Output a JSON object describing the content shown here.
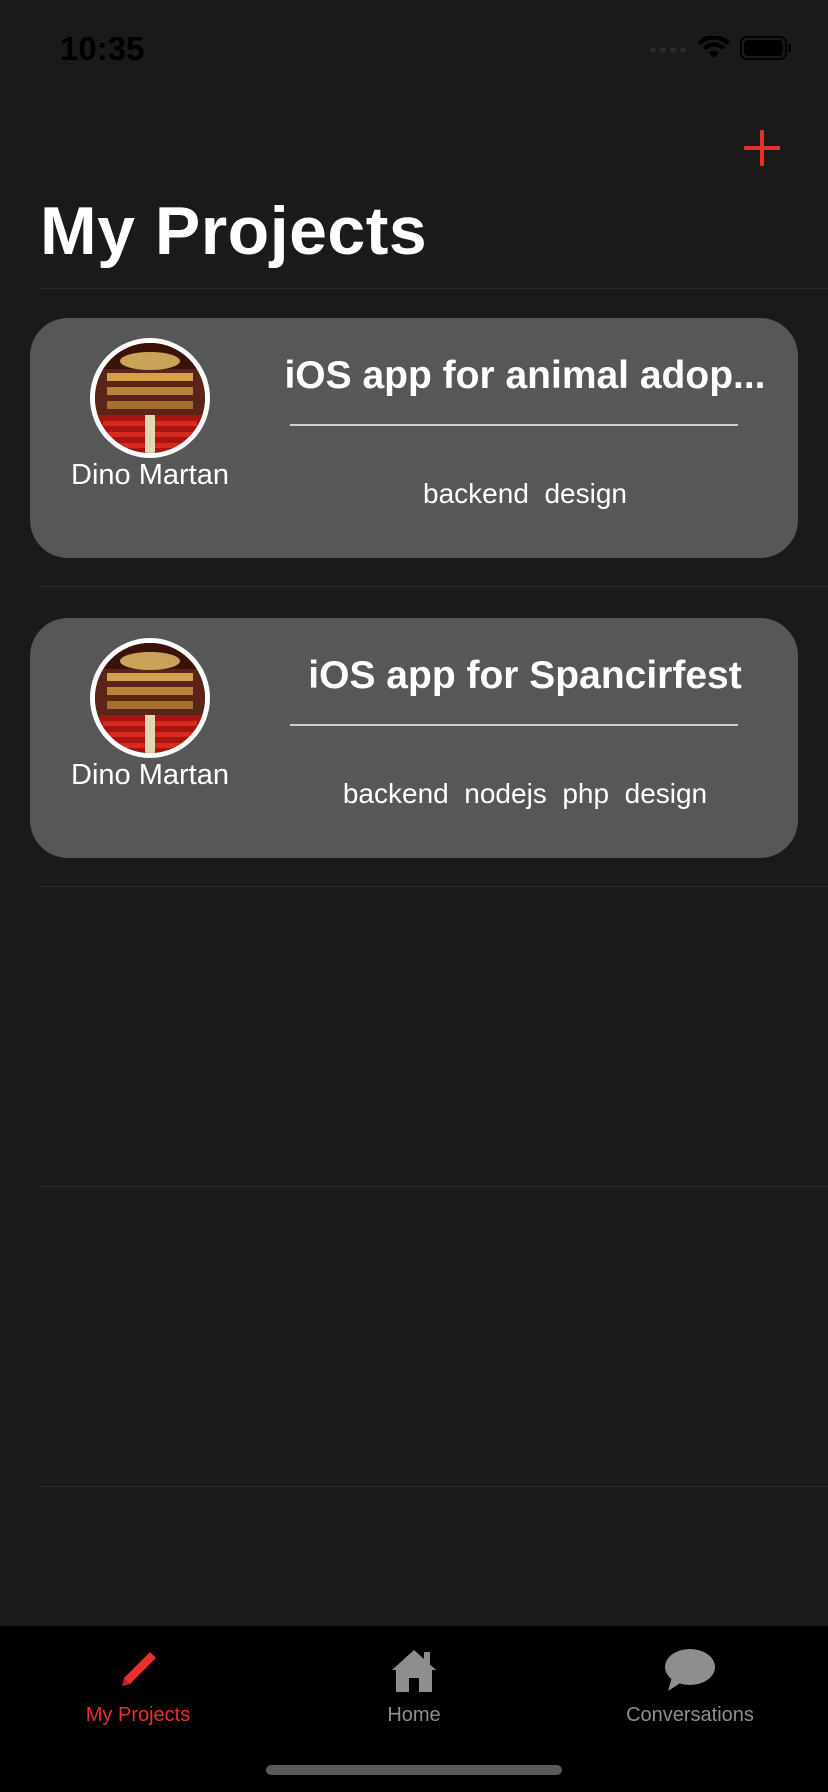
{
  "status_bar": {
    "time": "10:35"
  },
  "nav": {
    "title": "My Projects",
    "add_icon": "plus-icon"
  },
  "projects": [
    {
      "owner_name": "Dino Martan",
      "title": "iOS app for animal adop...",
      "tags": "backend  design"
    },
    {
      "owner_name": "Dino Martan",
      "title": "iOS app for Spancirfest",
      "tags": "backend  nodejs  php  design"
    }
  ],
  "tab_bar": {
    "tabs": [
      {
        "label": "My Projects",
        "icon": "pencil-icon",
        "selected": true
      },
      {
        "label": "Home",
        "icon": "house-icon",
        "selected": false
      },
      {
        "label": "Conversations",
        "icon": "speech-bubble-icon",
        "selected": false
      }
    ]
  },
  "colors": {
    "accent": "#e8302c",
    "background": "#1a1a1a",
    "card": "#575757",
    "tab_inactive": "#8e8e8e"
  }
}
